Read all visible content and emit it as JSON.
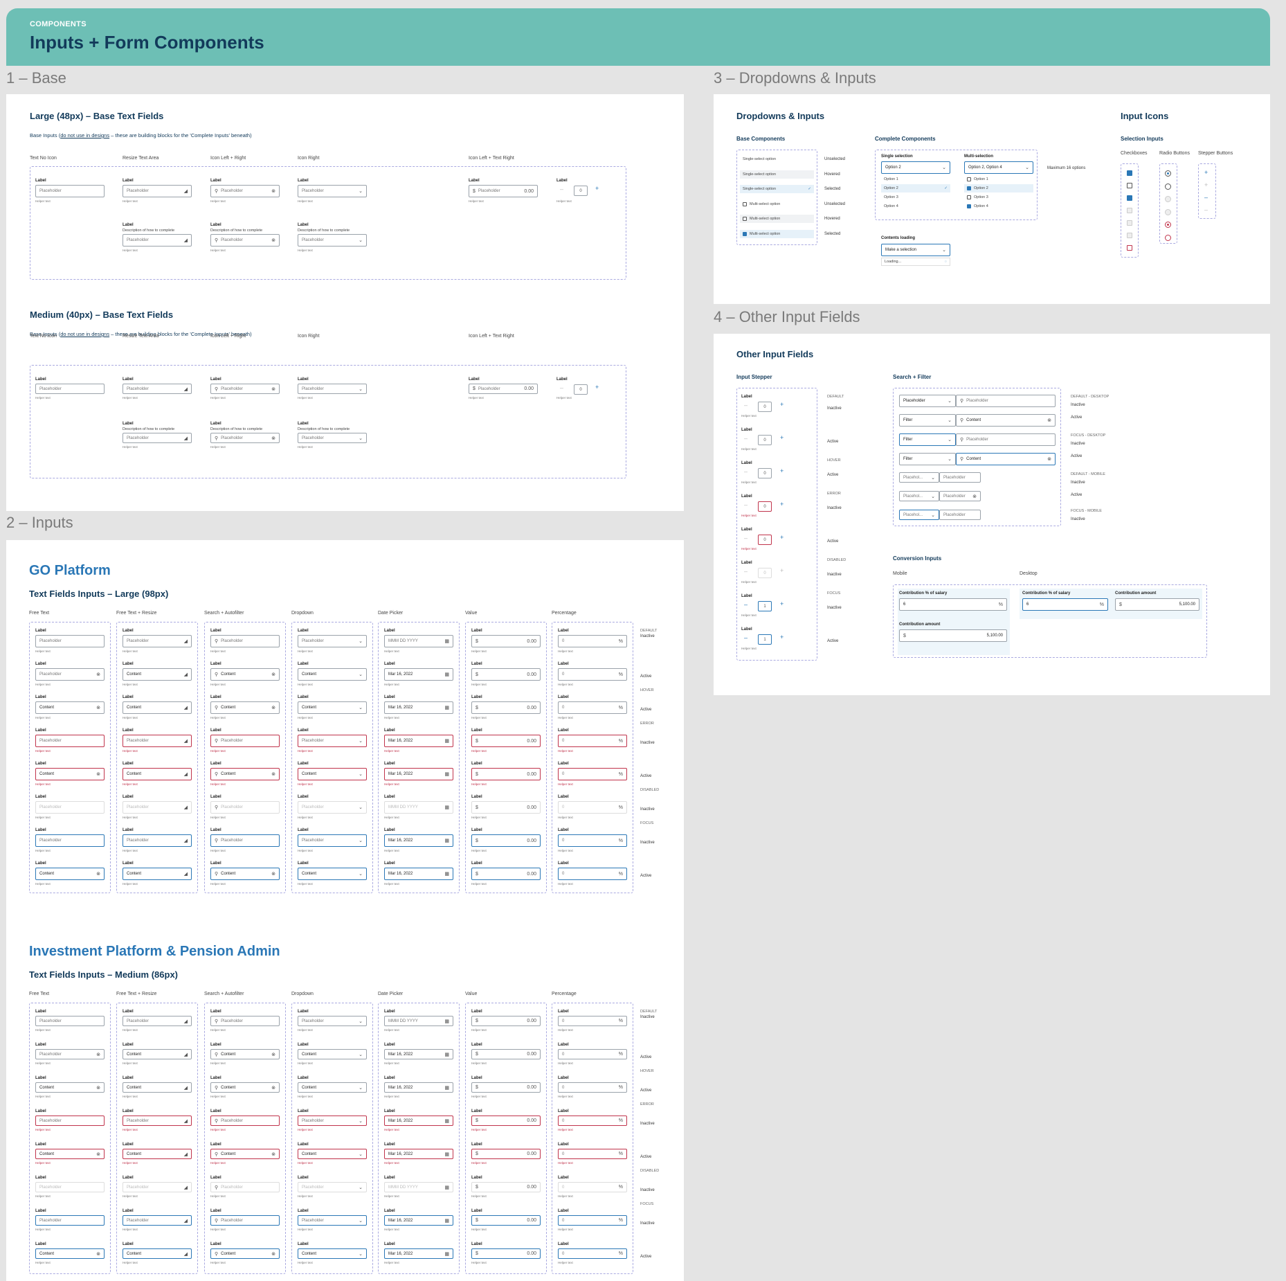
{
  "header": {
    "kicker": "COMPONENTS",
    "title": "Inputs + Form Components"
  },
  "sections": {
    "base": "1 – Base",
    "inputs": "2 – Inputs",
    "dropdowns": "3 – Dropdowns & Inputs",
    "other": "4 – Other Input Fields"
  },
  "common": {
    "label": "Label",
    "placeholder": "Placeholder",
    "helper": "Helper text",
    "description": "Description of how to complete",
    "content": "Content",
    "zero": "0",
    "amount": "0.00",
    "date": "Mar 16, 2022",
    "date_placeholder": "MMM DD YYYY",
    "dollar": "$",
    "percent": "%",
    "one": "1"
  },
  "base": {
    "large_title": "Large (48px) – Base Text Fields",
    "medium_title": "Medium (40px) – Base Text Fields",
    "note_pre": "Base Inputs (",
    "note_link": "do not use in designs",
    "note_post": " – these are building blocks for the 'Complete Inputs' beneath)",
    "cols": [
      "Text No Icon",
      "Resize Text Area",
      "Icon Left + Right",
      "Icon Right",
      "Icon Left + Text Right"
    ]
  },
  "inputs": {
    "go_title": "GO Platform",
    "go_sub": "Text Fields Inputs – Large (98px)",
    "inv_title": "Investment Platform & Pension Admin",
    "inv_sub": "Text Fields Inputs – Medium (86px)",
    "cols": [
      "Free Text",
      "Free Text + Resize",
      "Search + Autofilter",
      "Dropdown",
      "Date Picker",
      "Value",
      "Percentage"
    ],
    "state_caps": [
      "DEFAULT",
      "HOVER",
      "ERROR",
      "DISABLED",
      "FOCUS"
    ],
    "state_vals": [
      "Inactive",
      "Active",
      "Active",
      "Inactive",
      "Active",
      "Inactive",
      "Inactive",
      "Active"
    ]
  },
  "dropdowns": {
    "title": "Dropdowns & Inputs",
    "base_components": "Base Components",
    "complete_components": "Complete Components",
    "single_option": "Single-select option",
    "multi_option": "Multi-select option",
    "option_states": [
      "Unselected",
      "Hovered",
      "Selected",
      "Unselected",
      "Hovered",
      "Selected"
    ],
    "single_selection": "Single selection",
    "multi_selection": "Multi-selection",
    "single_value": "Option 2",
    "multi_value": "Option 2, Option 4",
    "options": [
      "Option 1",
      "Option 2",
      "Option 3",
      "Option 4"
    ],
    "max_note": "Maximum 16 options",
    "contents_loading": "Contents loading",
    "make_selection": "Make a selection",
    "loading": "Loading..."
  },
  "icons": {
    "title": "Input Icons",
    "selection": "Selection Inputs",
    "checkboxes": "Checkboxes",
    "radios": "Radio Buttons",
    "stepper": "Stepper Buttons"
  },
  "other": {
    "title": "Other Input Fields",
    "stepper": "Input Stepper",
    "search_filter": "Search + Filter",
    "stepper_caps": [
      "DEFAULT",
      "HOVER",
      "ERROR",
      "DISABLED",
      "FOCUS"
    ],
    "stepper_vals": [
      "Inactive",
      "Active",
      "Active",
      "Inactive",
      "Active",
      "Inactive",
      "Inactive",
      "Active"
    ],
    "filter": "Filter",
    "placeholder_short": "Placehol...",
    "sf_caps": [
      "DEFAULT - DESKTOP",
      "FOCUS - DESKTOP",
      "DEFAULT - MOBILE",
      "FOCUS - MOBILE"
    ],
    "sf_vals": [
      "Inactive",
      "Active",
      "Inactive",
      "Active",
      "Inactive",
      "Active",
      "Inactive"
    ],
    "conversion": "Conversion Inputs",
    "mobile": "Mobile",
    "desktop": "Desktop",
    "contribution_pct": "Contribution % of salary",
    "contribution_amt": "Contribution amount",
    "pct_value": "6",
    "amt_value": "5,100.00"
  },
  "colors": {
    "accent": "#2a77b6",
    "header": "#6dbfb5",
    "error": "#c0334b",
    "navy": "#123a5a"
  }
}
